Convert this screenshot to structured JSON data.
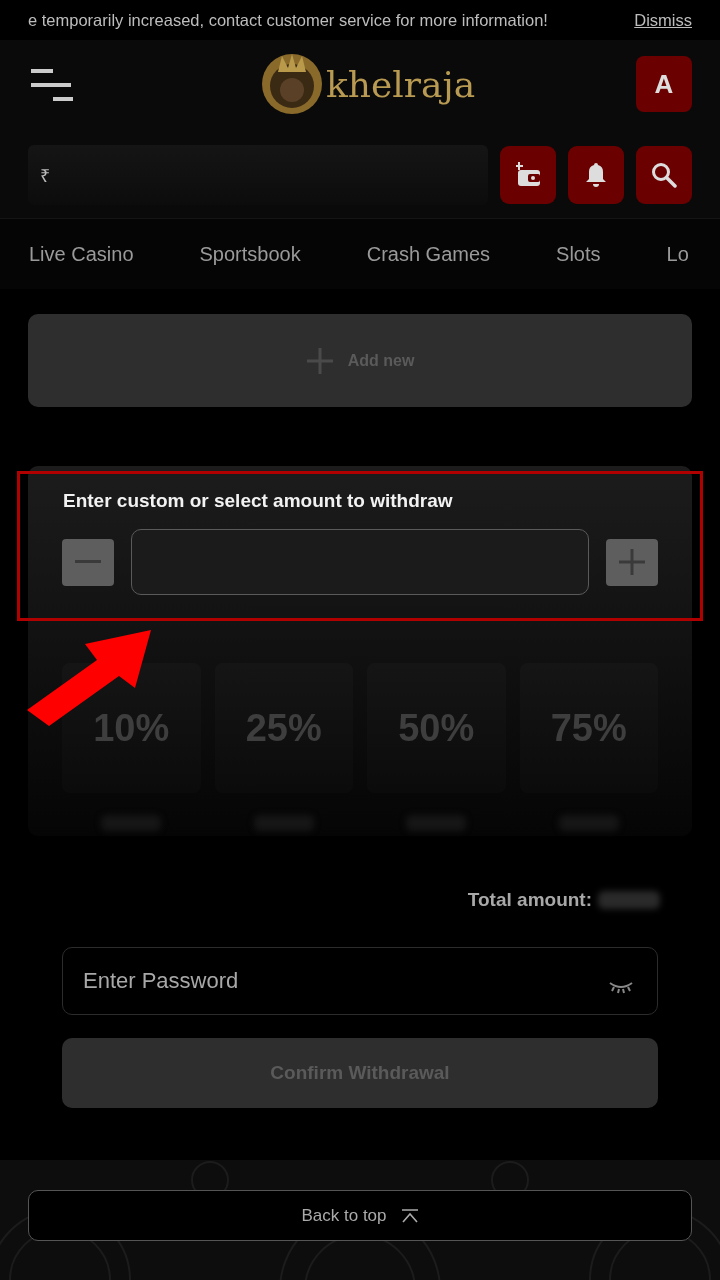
{
  "notice": {
    "text": "e temporarily increased, contact customer service for more information!",
    "dismiss": "Dismiss"
  },
  "header": {
    "logo": "khelraja",
    "avatar": "A"
  },
  "balance": {
    "currency": "₹"
  },
  "tabs": [
    {
      "label": "Live Casino",
      "selected": false
    },
    {
      "label": "Sportsbook",
      "selected": false
    },
    {
      "label": "Crash Games",
      "selected": false
    },
    {
      "label": "Slots",
      "selected": false
    },
    {
      "label": "Lo",
      "selected": false
    }
  ],
  "add_new": {
    "label": "Add new"
  },
  "withdraw": {
    "title": "Enter custom or select amount to withdraw",
    "presets": [
      {
        "label": "10%"
      },
      {
        "label": "25%"
      },
      {
        "label": "50%"
      },
      {
        "label": "75%"
      }
    ]
  },
  "total": {
    "label": "Total amount:"
  },
  "password": {
    "placeholder": "Enter Password"
  },
  "confirm": {
    "label": "Confirm Withdrawal",
    "disabled": true
  },
  "back_to_top": {
    "label": "Back to top"
  }
}
